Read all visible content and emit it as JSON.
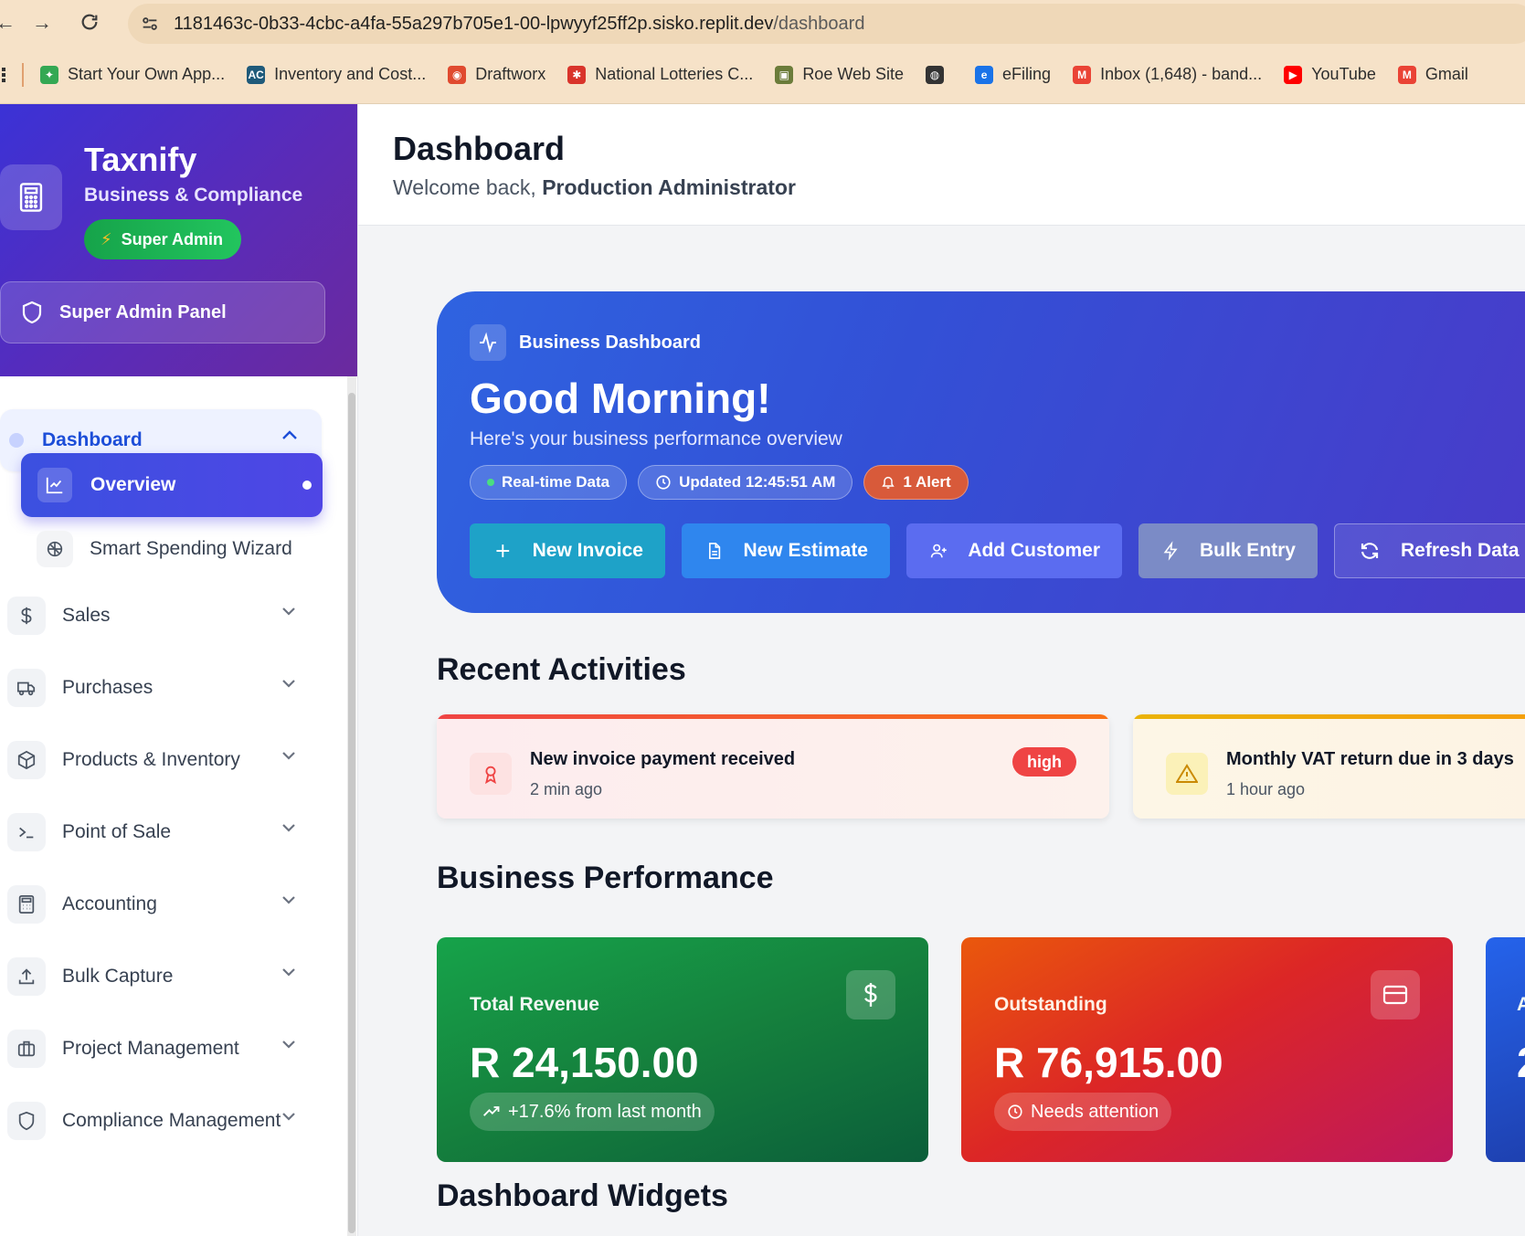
{
  "browser": {
    "url_host": "1181463c-0b33-4cbc-a4fa-55a297b705e1-00-lpwyyf25ff2p.sisko.replit.dev",
    "url_path": "/dashboard",
    "bookmarks": [
      {
        "label": "Start Your Own App...",
        "icon": "google-apps-icon",
        "color": "#34a853"
      },
      {
        "label": "Inventory and Cost...",
        "icon": "ac-icon",
        "color": "#1f5a7a"
      },
      {
        "label": "Draftworx",
        "icon": "draftworx-icon",
        "color": "#e04a2f"
      },
      {
        "label": "National Lotteries C...",
        "icon": "lotteries-icon",
        "color": "#d9342b"
      },
      {
        "label": "Roe Web Site",
        "icon": "roe-icon",
        "color": "#6b7c3a"
      },
      {
        "label": "",
        "icon": "globe-icon",
        "color": "#333333"
      },
      {
        "label": "eFiling",
        "icon": "efiling-icon",
        "color": "#1a73e8"
      },
      {
        "label": "Inbox (1,648) - band...",
        "icon": "gmail-icon",
        "color": "#ea4335"
      },
      {
        "label": "YouTube",
        "icon": "youtube-icon",
        "color": "#ff0000"
      },
      {
        "label": "Gmail",
        "icon": "gmail-icon",
        "color": "#ea4335"
      }
    ]
  },
  "sidebar": {
    "brand_title": "Taxnify",
    "brand_subtitle": "Business & Compliance",
    "role_badge": "Super Admin",
    "panel_button": "Super Admin Panel",
    "section_label": "Dashboard",
    "active_sub": "Overview",
    "sub_item": "Smart Spending Wizard",
    "items": [
      {
        "label": "Sales",
        "icon": "dollar-icon"
      },
      {
        "label": "Purchases",
        "icon": "truck-icon"
      },
      {
        "label": "Products & Inventory",
        "icon": "box-icon"
      },
      {
        "label": "Point of Sale",
        "icon": "terminal-icon"
      },
      {
        "label": "Accounting",
        "icon": "calculator-icon"
      },
      {
        "label": "Bulk Capture",
        "icon": "upload-icon"
      },
      {
        "label": "Project Management",
        "icon": "briefcase-icon"
      },
      {
        "label": "Compliance Management",
        "icon": "shield-icon"
      }
    ]
  },
  "header": {
    "title": "Dashboard",
    "welcome_prefix": "Welcome back,",
    "user_name": "Production Administrator"
  },
  "hero": {
    "tag": "Business Dashboard",
    "greeting": "Good Morning!",
    "description": "Here's your business performance overview",
    "chips": {
      "realtime": "Real-time Data",
      "updated": "Updated 12:45:51 AM",
      "alert": "1 Alert"
    },
    "actions": {
      "new_invoice": "New Invoice",
      "new_estimate": "New Estimate",
      "add_customer": "Add Customer",
      "bulk_entry": "Bulk Entry",
      "refresh": "Refresh Data"
    }
  },
  "sections": {
    "recent": "Recent Activities",
    "performance": "Business Performance",
    "widgets": "Dashboard Widgets"
  },
  "activities": [
    {
      "title": "New invoice payment received",
      "time": "2 min ago",
      "priority": "high"
    },
    {
      "title": "Monthly VAT return due in 3 days",
      "time": "1 hour ago"
    }
  ],
  "stats": {
    "revenue": {
      "label": "Total Revenue",
      "value": "R 24,150.00",
      "note": "+17.6% from last month"
    },
    "outstanding": {
      "label": "Outstanding",
      "value": "R 76,915.00",
      "note": "Needs attention"
    },
    "third_label": "A",
    "third_value": "2"
  }
}
